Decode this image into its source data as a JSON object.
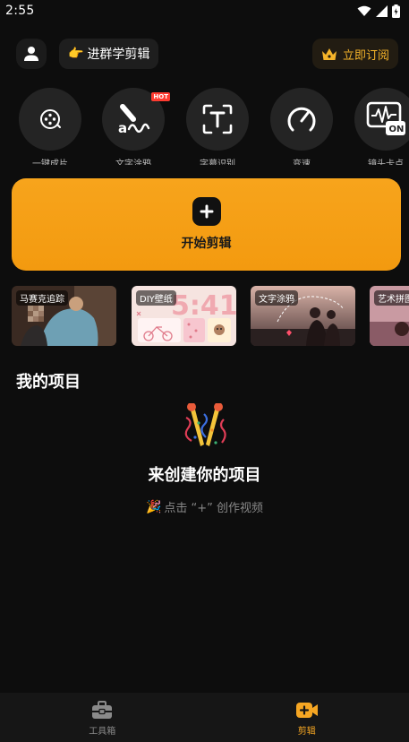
{
  "status": {
    "time": "2:55"
  },
  "header": {
    "group_label": "进群学剪辑",
    "subscribe_label": "立即订阅"
  },
  "tools": [
    {
      "label": "一键成片",
      "icon": "film-reel-icon"
    },
    {
      "label": "文字涂鸦",
      "icon": "brush-text-icon",
      "badge": "HOT"
    },
    {
      "label": "字幕识别",
      "icon": "text-recognize-icon"
    },
    {
      "label": "变速",
      "icon": "speedometer-icon"
    },
    {
      "label": "镜头卡点",
      "icon": "pulse-on-icon",
      "icon_text": "ON"
    }
  ],
  "start_card": {
    "label": "开始剪辑"
  },
  "templates": [
    {
      "tag": "马赛克追踪"
    },
    {
      "tag": "DIY壁纸",
      "overlay": "5:41"
    },
    {
      "tag": "文字涂鸦"
    },
    {
      "tag": "艺术拼图"
    }
  ],
  "projects": {
    "title": "我的项目",
    "empty_title": "来创建你的项目",
    "empty_hint": "点击 “+” 创作视频"
  },
  "nav": {
    "toolbox_label": "工具箱",
    "edit_label": "剪辑"
  },
  "colors": {
    "accent": "#f5a623",
    "background": "#0d0d0d",
    "nav_active": "#f5a623",
    "nav_inactive": "#8a8a8a"
  }
}
